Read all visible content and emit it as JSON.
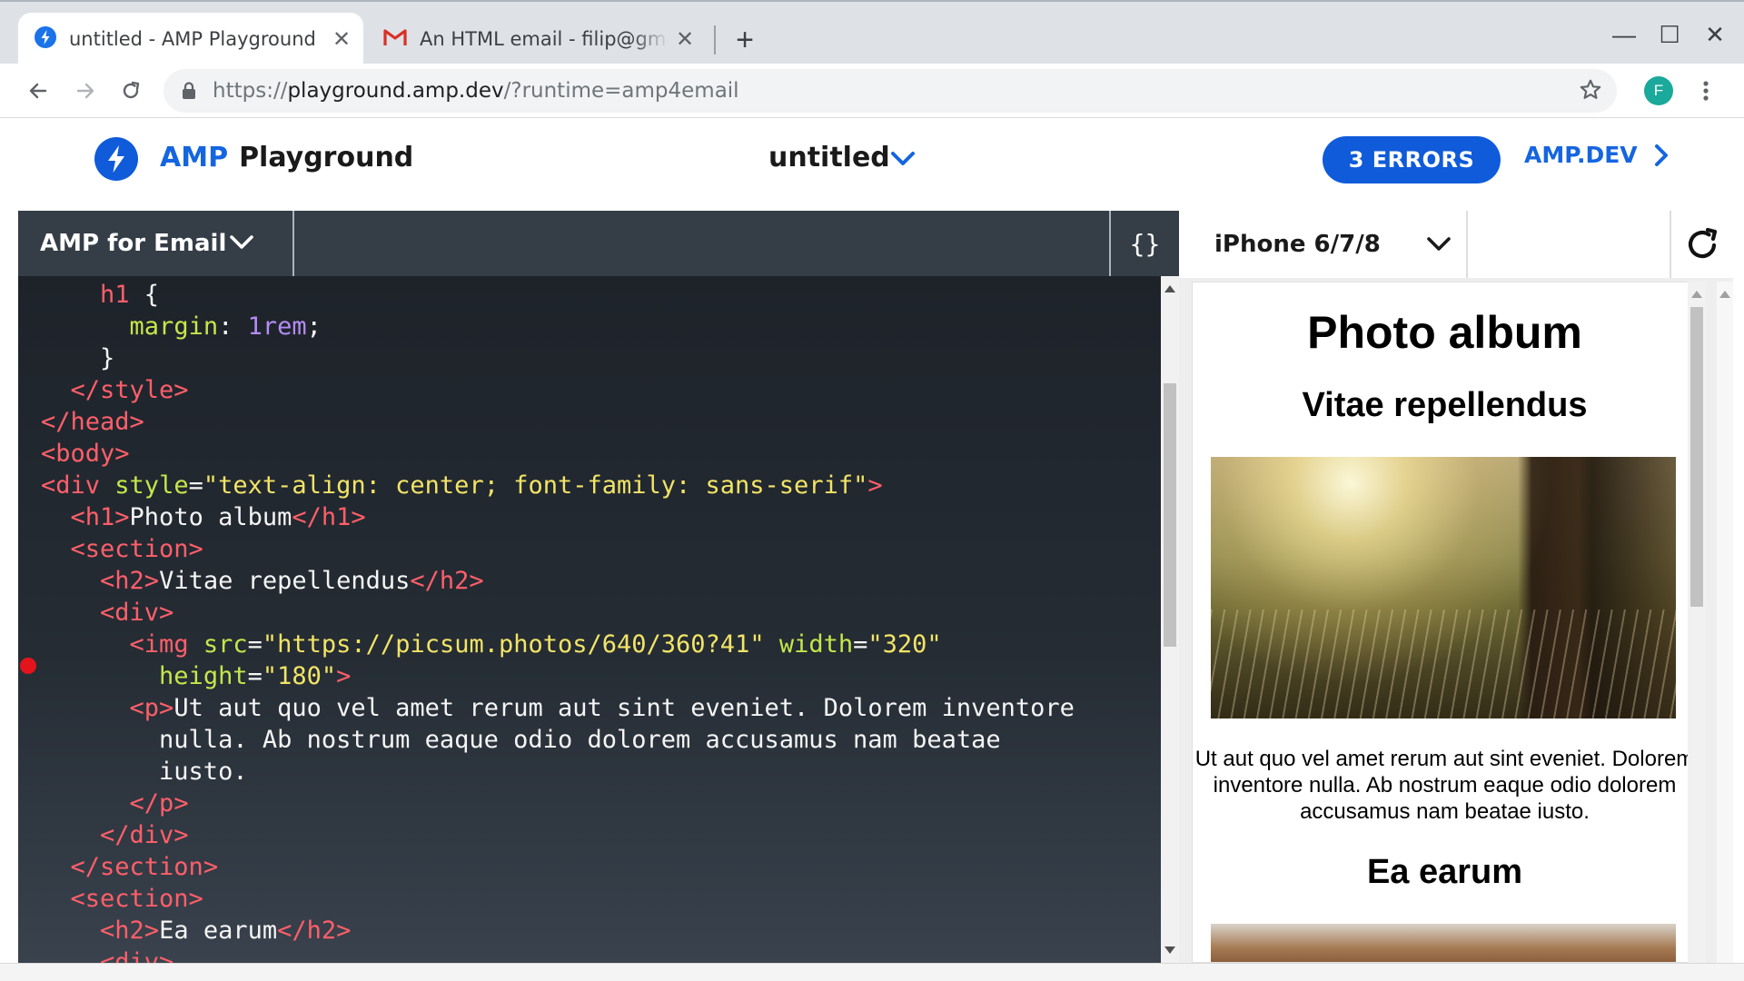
{
  "browser": {
    "tabs": [
      {
        "title": "untitled - AMP Playground",
        "icon": "amp-bolt-icon",
        "active": true
      },
      {
        "title": "An HTML email - filip@gmail.com",
        "icon": "gmail-icon",
        "active": false
      }
    ],
    "close_glyph": "✕",
    "new_tab_glyph": "+",
    "window_controls": {
      "minimize": "—",
      "maximize": "☐",
      "close": "✕"
    },
    "url": {
      "scheme": "https://",
      "host": "playground.amp.dev",
      "path": "/?runtime=amp4email"
    },
    "profile_initial": "F"
  },
  "header": {
    "brand_amp": "AMP",
    "brand_playground": "Playground",
    "doc_title": "untitled",
    "errors_label": "3 ERRORS",
    "ampdev_label": "AMP.DEV",
    "accent_color": "#1565e0"
  },
  "editor": {
    "runtime_label": "AMP for Email",
    "format_label": "{}",
    "breakpoint_line": 12,
    "lines": [
      [
        "    ",
        {
          "t": "h1"
        },
        " {"
      ],
      [
        "      ",
        {
          "a": "margin"
        },
        ": ",
        {
          "n": "1rem"
        },
        ";"
      ],
      [
        "    }"
      ],
      [
        "  ",
        {
          "t": "</style>"
        }
      ],
      [
        {
          "t": "</head>"
        }
      ],
      [
        {
          "t": "<body>"
        }
      ],
      [
        {
          "t": "<div"
        },
        " ",
        {
          "a": "style"
        },
        "=",
        {
          "s": "\"text-align: center; font-family: sans-serif\""
        },
        {
          "t": ">"
        }
      ],
      [
        "  ",
        {
          "t": "<h1>"
        },
        "Photo album",
        {
          "t": "</h1>"
        }
      ],
      [
        "  ",
        {
          "t": "<section>"
        }
      ],
      [
        "    ",
        {
          "t": "<h2>"
        },
        "Vitae repellendus",
        {
          "t": "</h2>"
        }
      ],
      [
        "    ",
        {
          "t": "<div>"
        }
      ],
      [
        "      ",
        {
          "t": "<img"
        },
        " ",
        {
          "a": "src"
        },
        "=",
        {
          "s": "\"https://picsum.photos/640/360?41\""
        },
        " ",
        {
          "a": "width"
        },
        "=",
        {
          "s": "\"320\""
        }
      ],
      [
        "        ",
        {
          "a": "height"
        },
        "=",
        {
          "s": "\"180\""
        },
        {
          "t": ">"
        }
      ],
      [
        "      ",
        {
          "t": "<p>"
        },
        "Ut aut quo vel amet rerum aut sint eveniet. Dolorem inventore"
      ],
      [
        "        nulla. Ab nostrum eaque odio dolorem accusamus nam beatae"
      ],
      [
        "        iusto."
      ],
      [
        "      ",
        {
          "t": "</p>"
        }
      ],
      [
        "    ",
        {
          "t": "</div>"
        }
      ],
      [
        "  ",
        {
          "t": "</section>"
        }
      ],
      [
        "  ",
        {
          "t": "<section>"
        }
      ],
      [
        "    ",
        {
          "t": "<h2>"
        },
        "Ea earum",
        {
          "t": "</h2>"
        }
      ],
      [
        "    ",
        {
          "t": "<div>"
        }
      ]
    ]
  },
  "preview": {
    "device_label": "iPhone 6/7/8",
    "h1": "Photo album",
    "sections": [
      {
        "h2": "Vitae repellendus",
        "text": "Ut aut quo vel amet rerum aut sint eveniet. Dolorem inventore nulla. Ab nostrum eaque odio dolorem accusamus nam beatae iusto."
      },
      {
        "h2": "Ea earum"
      }
    ]
  }
}
